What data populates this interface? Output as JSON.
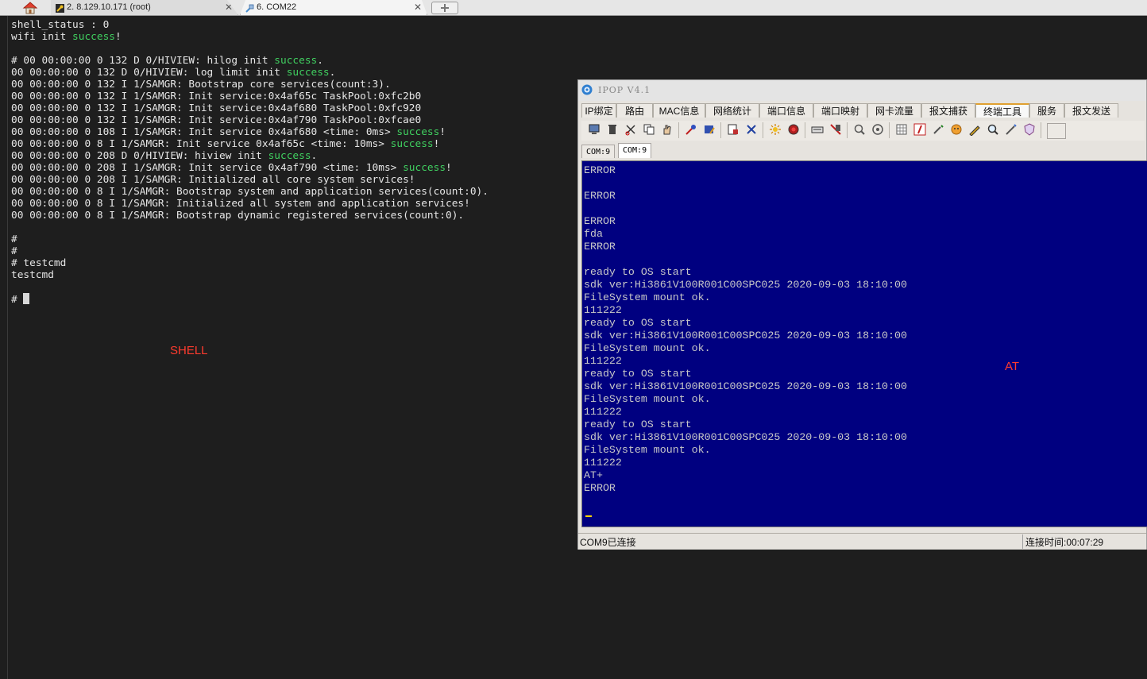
{
  "tabs": [
    {
      "label": "2. 8.129.10.171 (root)"
    },
    {
      "label": "6. COM22"
    }
  ],
  "shell_label": "SHELL",
  "at_label": "AT",
  "ipop": {
    "title": "IPOP V4.1",
    "menu_tabs": [
      "IP绑定",
      "路由",
      "MAC信息",
      "网络统计",
      "端口信息",
      "端口映射",
      "网卡流量",
      "报文捕获",
      "终端工具",
      "服务",
      "报文发送"
    ],
    "active_menu_tab": "终端工具",
    "com_tabs": [
      "COM:9",
      "COM:9"
    ],
    "console_lines": [
      "ERROR",
      "",
      "ERROR",
      "",
      "ERROR",
      "fda",
      "ERROR",
      "",
      "ready to OS start",
      "sdk ver:Hi3861V100R001C00SPC025 2020-09-03 18:10:00",
      "FileSystem mount ok.",
      "111222",
      "ready to OS start",
      "sdk ver:Hi3861V100R001C00SPC025 2020-09-03 18:10:00",
      "FileSystem mount ok.",
      "111222",
      "ready to OS start",
      "sdk ver:Hi3861V100R001C00SPC025 2020-09-03 18:10:00",
      "FileSystem mount ok.",
      "111222",
      "ready to OS start",
      "sdk ver:Hi3861V100R001C00SPC025 2020-09-03 18:10:00",
      "FileSystem mount ok.",
      "111222",
      "AT+",
      "ERROR"
    ],
    "status_left": "COM9已连接",
    "status_right": "连接时间:00:07:29"
  },
  "terminal_lines": [
    [
      {
        "t": "shell_status : 0"
      }
    ],
    [
      {
        "t": "wifi init "
      },
      {
        "t": "success",
        "ok": true
      },
      {
        "t": "!"
      }
    ],
    [
      {
        "t": ""
      }
    ],
    [
      {
        "t": "# 00 00:00:00 0 132 D 0/HIVIEW: hilog init "
      },
      {
        "t": "success",
        "ok": true
      },
      {
        "t": "."
      }
    ],
    [
      {
        "t": "00 00:00:00 0 132 D 0/HIVIEW: log limit init "
      },
      {
        "t": "success",
        "ok": true
      },
      {
        "t": "."
      }
    ],
    [
      {
        "t": "00 00:00:00 0 132 I 1/SAMGR: Bootstrap core services(count:3)."
      }
    ],
    [
      {
        "t": "00 00:00:00 0 132 I 1/SAMGR: Init service:0x4af65c TaskPool:0xfc2b0"
      }
    ],
    [
      {
        "t": "00 00:00:00 0 132 I 1/SAMGR: Init service:0x4af680 TaskPool:0xfc920"
      }
    ],
    [
      {
        "t": "00 00:00:00 0 132 I 1/SAMGR: Init service:0x4af790 TaskPool:0xfcae0"
      }
    ],
    [
      {
        "t": "00 00:00:00 0 108 I 1/SAMGR: Init service 0x4af680 <time: 0ms> "
      },
      {
        "t": "success",
        "ok": true
      },
      {
        "t": "!"
      }
    ],
    [
      {
        "t": "00 00:00:00 0 8 I 1/SAMGR: Init service 0x4af65c <time: 10ms> "
      },
      {
        "t": "success",
        "ok": true
      },
      {
        "t": "!"
      }
    ],
    [
      {
        "t": "00 00:00:00 0 208 D 0/HIVIEW: hiview init "
      },
      {
        "t": "success",
        "ok": true
      },
      {
        "t": "."
      }
    ],
    [
      {
        "t": "00 00:00:00 0 208 I 1/SAMGR: Init service 0x4af790 <time: 10ms> "
      },
      {
        "t": "success",
        "ok": true
      },
      {
        "t": "!"
      }
    ],
    [
      {
        "t": "00 00:00:00 0 208 I 1/SAMGR: Initialized all core system services!"
      }
    ],
    [
      {
        "t": "00 00:00:00 0 8 I 1/SAMGR: Bootstrap system and application services(count:0)."
      }
    ],
    [
      {
        "t": "00 00:00:00 0 8 I 1/SAMGR: Initialized all system and application services!"
      }
    ],
    [
      {
        "t": "00 00:00:00 0 8 I 1/SAMGR: Bootstrap dynamic registered services(count:0)."
      }
    ],
    [
      {
        "t": ""
      }
    ],
    [
      {
        "t": "#"
      }
    ],
    [
      {
        "t": "#"
      }
    ],
    [
      {
        "t": "# testcmd"
      }
    ],
    [
      {
        "t": "testcmd"
      }
    ],
    [
      {
        "t": ""
      }
    ],
    [
      {
        "t": "# "
      },
      {
        "cursor": true
      }
    ]
  ]
}
